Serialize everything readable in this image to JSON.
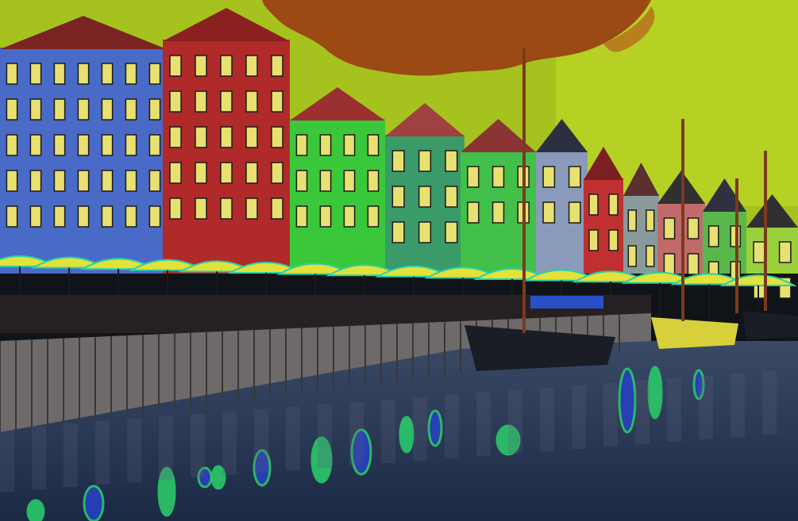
{
  "scene": {
    "kind": "photo-posterized",
    "subject": "harbor-canal-with-colorful-townhouses",
    "colors": {
      "sky": "#a6c21e",
      "sky_light": "#c4dc2a",
      "cloud": "#9a4a12",
      "cloud_edge": "#b86a1c",
      "water_top": "#3a4a66",
      "water_bottom": "#1a2a44",
      "quay": "#6e6a6a",
      "quay_dark": "#3a3636",
      "umbrella": "#e2e23a",
      "umbrella_edge": "#2bd0a8",
      "boat_hull": "#1a1c26",
      "boat_yellow": "#d8d03a",
      "mast": "#7a3a1e",
      "reflection_green": "#2ac86a",
      "reflection_blue": "#2840c0"
    },
    "buildings": [
      {
        "name": "blue-house",
        "color": "#4a6ac8",
        "roof": "#7a2424"
      },
      {
        "name": "red-house",
        "color": "#b02a2a",
        "roof": "#8a2020"
      },
      {
        "name": "green-house",
        "color": "#3ac83a",
        "roof": "#9a3030"
      },
      {
        "name": "teal-house",
        "color": "#3a9a6a",
        "roof": "#a04040"
      },
      {
        "name": "lime-house",
        "color": "#42c04a",
        "roof": "#8a3434"
      },
      {
        "name": "grey-blue-house",
        "color": "#8a9aba",
        "roof": "#2a3040"
      },
      {
        "name": "small-red-house",
        "color": "#c03030",
        "roof": "#7a2020"
      },
      {
        "name": "grey-house",
        "color": "#8a9a9a",
        "roof": "#5a3030"
      },
      {
        "name": "pink-house",
        "color": "#c06a6a",
        "roof": "#303030"
      },
      {
        "name": "far-green-house",
        "color": "#5ab84a",
        "roof": "#303040"
      },
      {
        "name": "far-lime-house",
        "color": "#9ad03a",
        "roof": "#303030"
      }
    ]
  }
}
